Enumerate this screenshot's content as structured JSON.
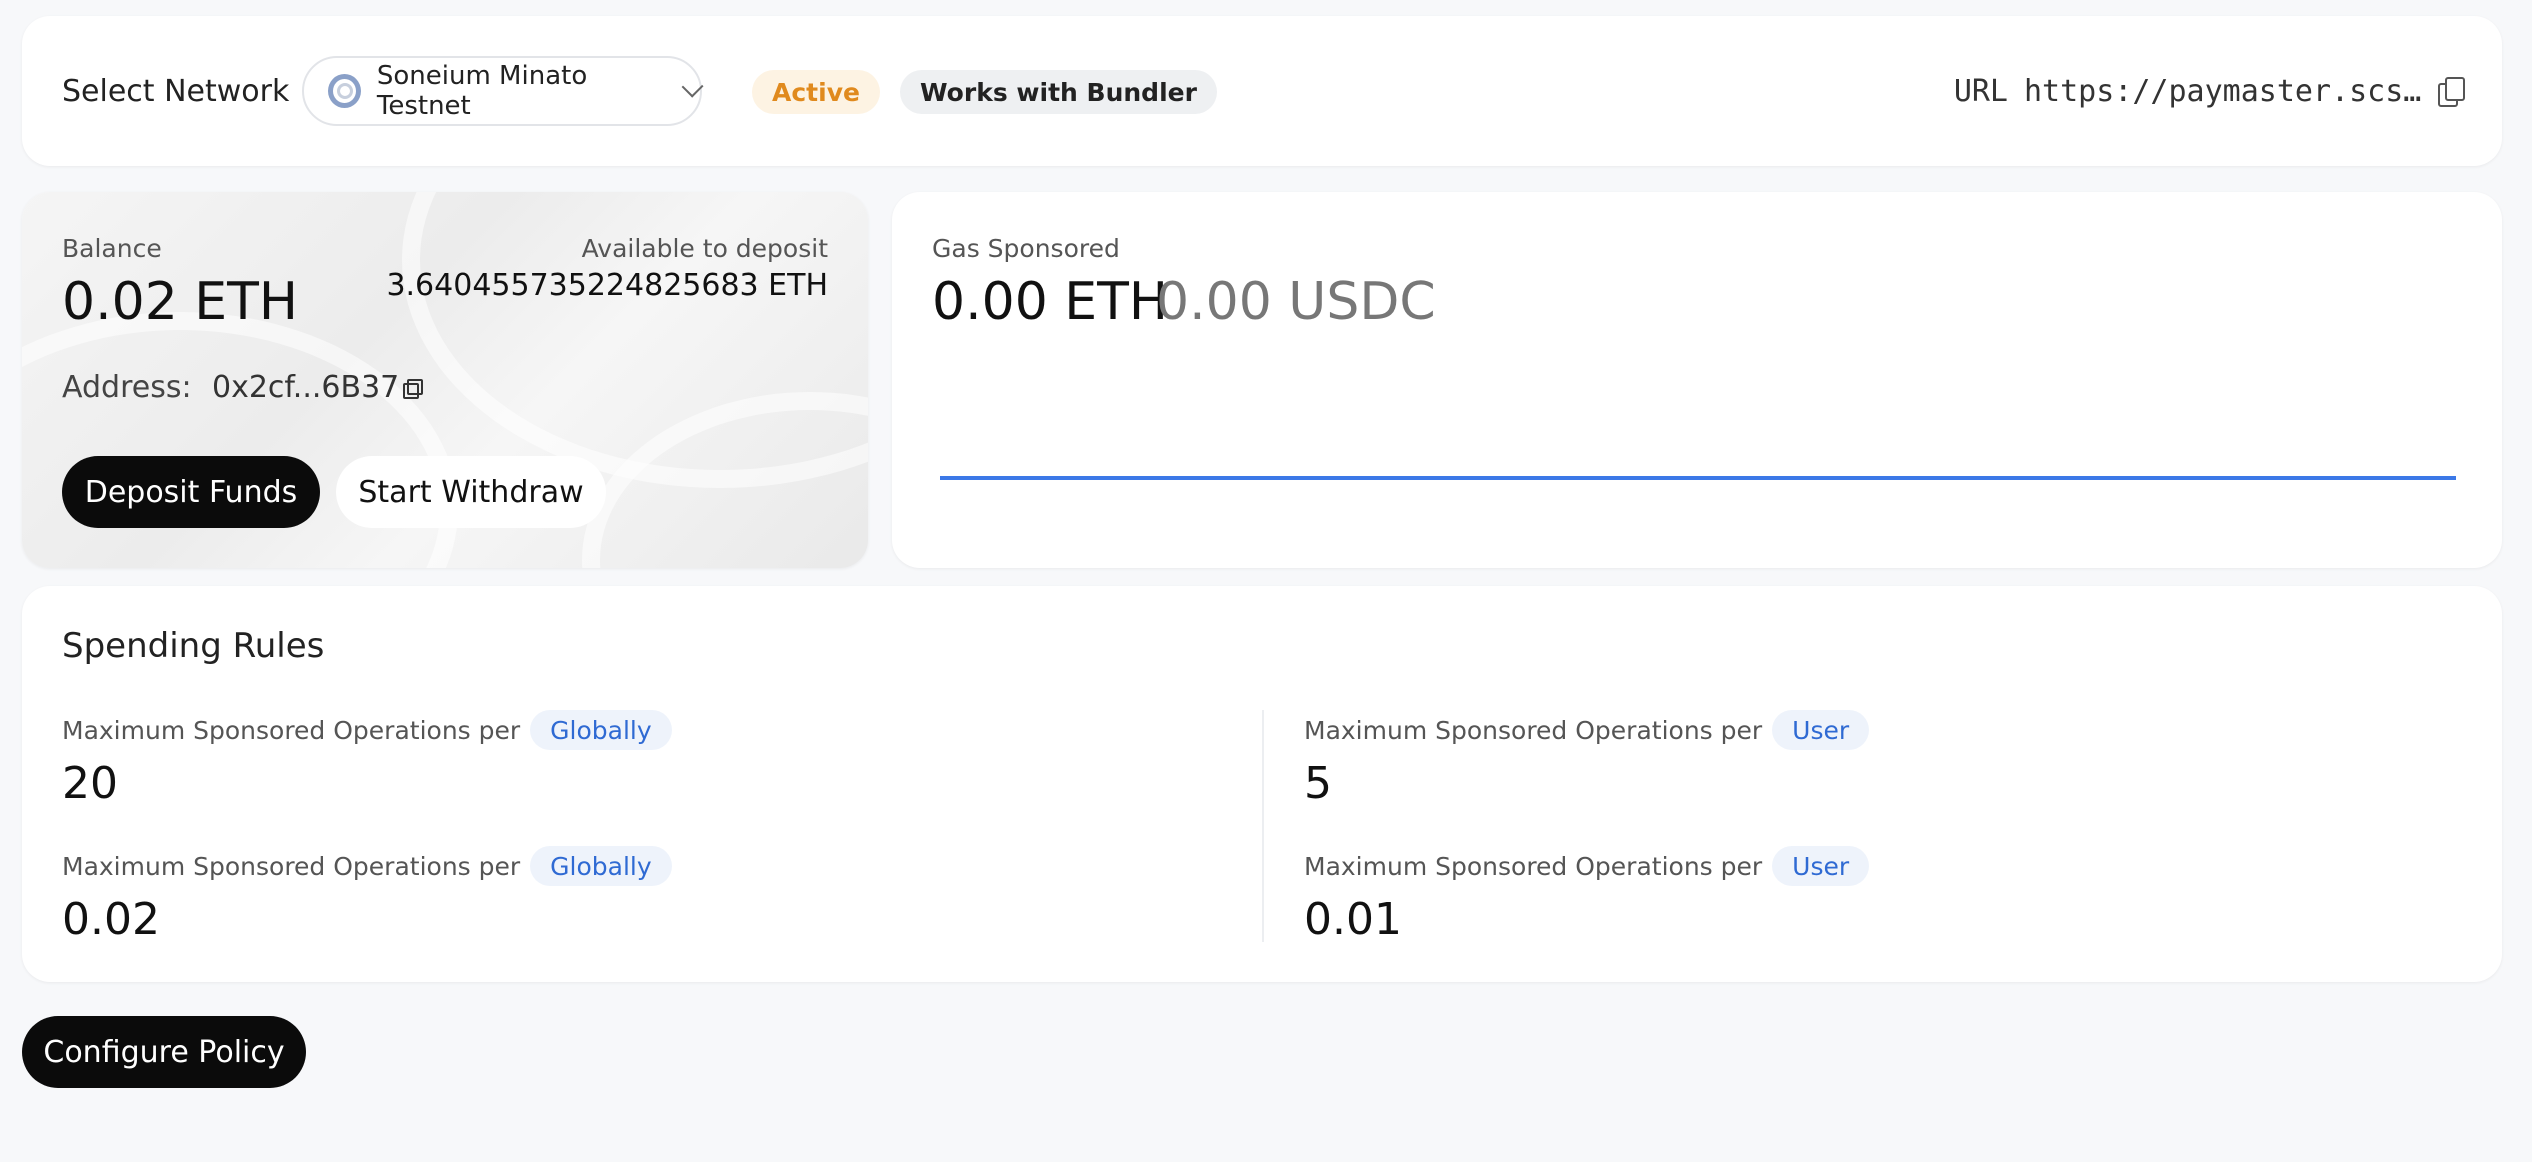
{
  "header": {
    "select_network_label": "Select Network",
    "network_name": "Soneium Minato Testnet",
    "status_badge": "Active",
    "bundler_badge": "Works with Bundler",
    "url_label": "URL",
    "url_value": "https://paymaster.scs…"
  },
  "balance": {
    "label": "Balance",
    "value": "0.02 ETH",
    "available_label": "Available to deposit",
    "available_value": "3.640455735224825683 ETH",
    "address_label": "Address:",
    "address_value": "0x2cf...6B37",
    "deposit_button": "Deposit Funds",
    "withdraw_button": "Start Withdraw"
  },
  "gas": {
    "label": "Gas Sponsored",
    "eth_value": "0.00 ETH",
    "usdc_value": "0.00 USDC",
    "line_color": "#3b78e7"
  },
  "rules": {
    "title": "Spending Rules",
    "items": [
      {
        "label": "Maximum Sponsored Operations per",
        "tag": "Globally",
        "value": "20"
      },
      {
        "label": "Maximum Sponsored Operations per",
        "tag": "User",
        "value": "5"
      },
      {
        "label": "Maximum Sponsored Operations per",
        "tag": "Globally",
        "value": "0.02"
      },
      {
        "label": "Maximum Sponsored Operations per",
        "tag": "User",
        "value": "0.01"
      }
    ]
  },
  "actions": {
    "configure_button": "Configure Policy"
  }
}
